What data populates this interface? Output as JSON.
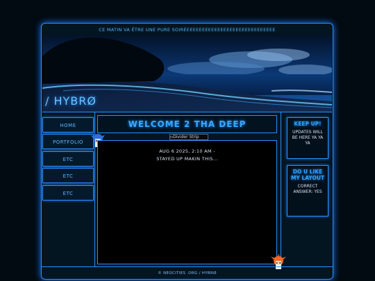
{
  "marquee": "CE MATIN VA ÊTRE UNE PURE SOIRÉEEEEEEEEEEEEEEEEEEEEEEEEEEEEE",
  "banner": {
    "logo": "/ HYBRØ"
  },
  "nav": [
    {
      "label": "HOME"
    },
    {
      "label": "PORTFOLIO"
    },
    {
      "label": "ETC"
    },
    {
      "label": "ETC"
    },
    {
      "label": "ETC"
    }
  ],
  "main": {
    "title": "WELCOME 2 THA DEEP",
    "divider_alt": "Divider Strip",
    "post_date": "AUG 6 2025, 2:10 AM -",
    "post_text": "STAYED UP MAKIN THIS..."
  },
  "sidebar": {
    "box1": {
      "heading": "KEEP UP!",
      "text": "UPDATES WILL BE HERE YA YA YA"
    },
    "box2": {
      "heading": "DO U LIKE MY LAYOUT",
      "text": "CORRECT ANSWER: YES"
    }
  },
  "footer": "© NEOCITIES .ORG / HYBRØ",
  "colors": {
    "accent": "#2a8fff",
    "background": "#041522",
    "text_glow": "#3aa8ff"
  }
}
